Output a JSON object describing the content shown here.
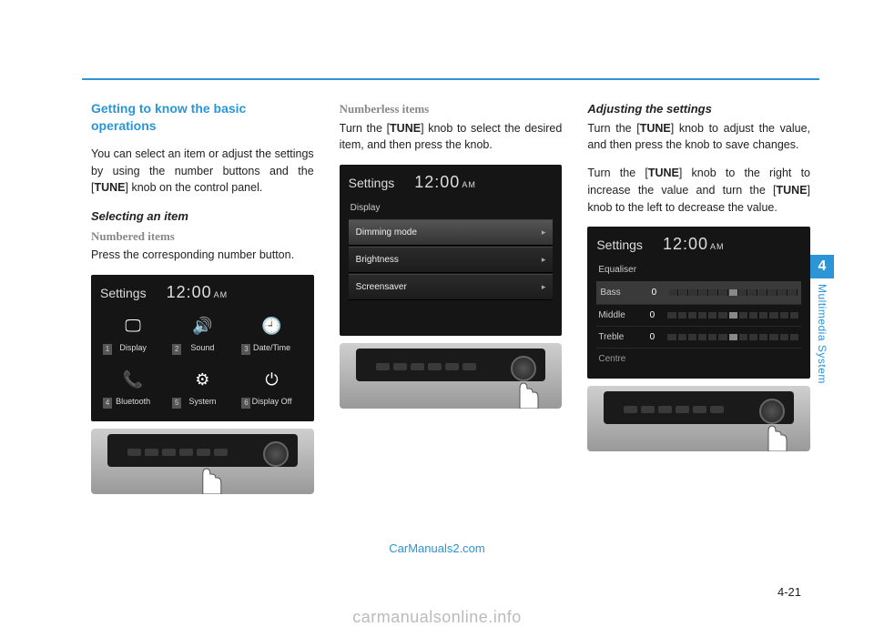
{
  "col1": {
    "heading": "Getting to know the basic operations",
    "intro_a": "You can select an item or adjust the settings by using the number buttons and the [",
    "intro_b": "TUNE",
    "intro_c": "] knob on the control panel.",
    "selecting": "Selecting an item",
    "numbered": "Numbered items",
    "press": "Press the corresponding number button.",
    "screen": {
      "title": "Settings",
      "time": "12:00",
      "ampm": "AM",
      "items": [
        {
          "n": "1",
          "label": "Display",
          "icon": "🖵"
        },
        {
          "n": "2",
          "label": "Sound",
          "icon": "🔊"
        },
        {
          "n": "3",
          "label": "Date/Time",
          "icon": "🕘"
        },
        {
          "n": "4",
          "label": "Bluetooth",
          "icon": "📞"
        },
        {
          "n": "5",
          "label": "System",
          "icon": "⚙"
        },
        {
          "n": "6",
          "label": "Display Off",
          "icon": "⏻"
        }
      ]
    }
  },
  "col2": {
    "numberless": "Numberless items",
    "p_a": "Turn the [",
    "p_b": "TUNE",
    "p_c": "] knob to select the desired item, and then press the knob.",
    "screen": {
      "title": "Settings",
      "time": "12:00",
      "ampm": "AM",
      "cat": "Display",
      "rows": [
        "Dimming mode",
        "Brightness",
        "Screensaver"
      ]
    }
  },
  "col3": {
    "adjusting": "Adjusting the settings",
    "p1_a": "Turn the [",
    "p1_b": "TUNE",
    "p1_c": "] knob to adjust the value, and then press the knob to save changes.",
    "p2_a": "Turn the [",
    "p2_b": "TUNE",
    "p2_c": "] knob to the right to increase the value and turn the [",
    "p2_d": "TUNE",
    "p2_e": "] knob to the left to decrease the value.",
    "screen": {
      "title": "Settings",
      "time": "12:00",
      "ampm": "AM",
      "cat": "Equaliser",
      "rows": [
        {
          "label": "Bass",
          "val": "0"
        },
        {
          "label": "Middle",
          "val": "0"
        },
        {
          "label": "Treble",
          "val": "0"
        }
      ],
      "last": "Centre"
    }
  },
  "tab": {
    "num": "4",
    "label": "Multimedia System"
  },
  "pagenum": "4-21",
  "wm1": "CarManuals2.com",
  "wm2": "carmanualsonline.info"
}
